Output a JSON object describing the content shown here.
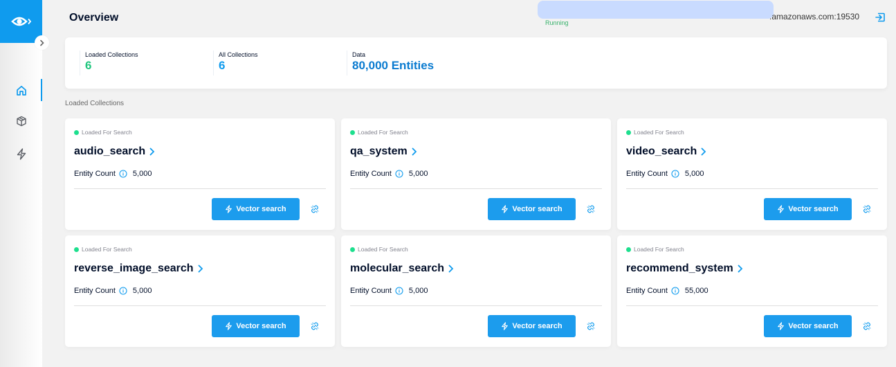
{
  "sidebar": {
    "logo_icon": "eye-logo-icon",
    "expand_icon": "chevron-right-icon",
    "items": [
      {
        "name": "overview",
        "icon": "home-icon",
        "active": true
      },
      {
        "name": "collections",
        "icon": "cube-icon",
        "active": false
      },
      {
        "name": "search",
        "icon": "lightning-icon",
        "active": false
      }
    ]
  },
  "header": {
    "title": "Overview",
    "address": ".amazonaws.com:19530",
    "status": "Running",
    "logout_icon": "logout-icon"
  },
  "stats": [
    {
      "label": "Loaded Collections",
      "value": "6"
    },
    {
      "label": "All Collections",
      "value": "6"
    },
    {
      "label": "Data",
      "value": "80,000 Entities"
    }
  ],
  "section_label": "Loaded Collections",
  "colors": {
    "accent": "#0f9bee",
    "loaded_green": "#20c67e",
    "running_green": "#36b16a",
    "status_dot": "#1ddf8e"
  },
  "cards": [
    {
      "status": "Loaded For Search",
      "name": "audio_search",
      "count_label": "Entity Count",
      "count": "5,000",
      "button": "Vector search"
    },
    {
      "status": "Loaded For Search",
      "name": "qa_system",
      "count_label": "Entity Count",
      "count": "5,000",
      "button": "Vector search"
    },
    {
      "status": "Loaded For Search",
      "name": "video_search",
      "count_label": "Entity Count",
      "count": "5,000",
      "button": "Vector search"
    },
    {
      "status": "Loaded For Search",
      "name": "reverse_image_search",
      "count_label": "Entity Count",
      "count": "5,000",
      "button": "Vector search"
    },
    {
      "status": "Loaded For Search",
      "name": "molecular_search",
      "count_label": "Entity Count",
      "count": "5,000",
      "button": "Vector search"
    },
    {
      "status": "Loaded For Search",
      "name": "recommend_system",
      "count_label": "Entity Count",
      "count": "55,000",
      "button": "Vector search"
    }
  ]
}
